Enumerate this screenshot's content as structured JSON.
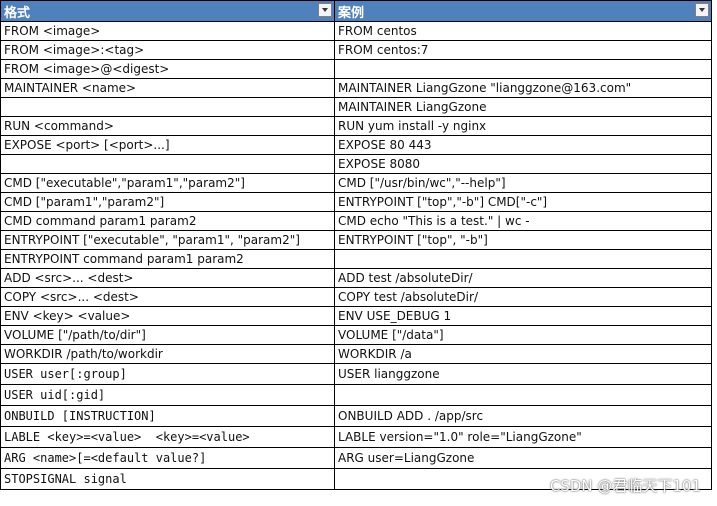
{
  "header": {
    "col_format": "格式",
    "col_example": "案例",
    "dropdown_icon": "dropdown-arrow-icon"
  },
  "rows": [
    {
      "format": "FROM <image>",
      "example": "FROM centos"
    },
    {
      "format": "FROM <image>:<tag>",
      "example": "FROM centos:7"
    },
    {
      "format": "FROM <image>@<digest>",
      "example": ""
    },
    {
      "format": "MAINTAINER <name>",
      "example": "MAINTAINER LiangGzone \"lianggzone@163.com\""
    },
    {
      "format": "",
      "example": "MAINTAINER LiangGzone"
    },
    {
      "format": "RUN <command>",
      "example": "RUN yum install -y nginx"
    },
    {
      "format": "EXPOSE <port> [<port>...]",
      "example": "EXPOSE 80 443"
    },
    {
      "format": "",
      "example": "EXPOSE 8080"
    },
    {
      "format": "CMD [\"executable\",\"param1\",\"param2\"]",
      "example": "CMD [\"/usr/bin/wc\",\"--help\"]"
    },
    {
      "format": "CMD [\"param1\",\"param2\"]",
      "example": "ENTRYPOINT [\"top\",\"-b\"] CMD[\"-c\"]"
    },
    {
      "format": "CMD command param1 param2",
      "example": "CMD echo \"This is a test.\" | wc -"
    },
    {
      "format": "ENTRYPOINT [\"executable\", \"param1\", \"param2\"]",
      "example": "ENTRYPOINT [\"top\", \"-b\"]"
    },
    {
      "format": "ENTRYPOINT command param1 param2",
      "example": ""
    },
    {
      "format": "ADD <src>... <dest>",
      "example": "ADD test /absoluteDir/"
    },
    {
      "format": "COPY <src>... <dest>",
      "example": "COPY test /absoluteDir/"
    },
    {
      "format": "ENV <key> <value>",
      "example": "ENV USE_DEBUG 1"
    },
    {
      "format": "VOLUME [\"/path/to/dir\"]",
      "example": "VOLUME [\"/data\"]"
    },
    {
      "format": "WORKDIR /path/to/workdir",
      "example": "WORKDIR /a"
    },
    {
      "format": "USER user[:group]",
      "example": "USER lianggzone"
    },
    {
      "format": "USER uid[:gid]",
      "example": ""
    },
    {
      "format": "ONBUILD [INSTRUCTION]",
      "example": "ONBUILD ADD . /app/src"
    },
    {
      "format": "LABLE <key>=<value>  <key>=<value>",
      "example": "LABLE version=\"1.0\" role=\"LiangGzone\""
    },
    {
      "format": "ARG <name>[=<default value?]",
      "example": "ARG user=LiangGzone"
    },
    {
      "format": "STOPSIGNAL signal",
      "example": ""
    }
  ],
  "watermark": "CSDN @君临天下101",
  "colors": {
    "header_bg": "#4f81bd",
    "header_text": "#ffffff",
    "grid": "#000000"
  }
}
